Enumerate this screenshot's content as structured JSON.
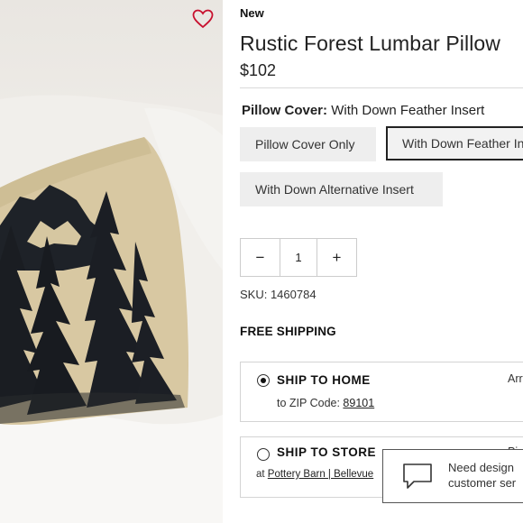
{
  "product": {
    "badge": "New",
    "title": "Rustic Forest Lumbar Pillow",
    "price": "$102",
    "wishlist_icon": "heart-icon",
    "option_label": "Pillow Cover:",
    "option_selected": "With Down Feather Insert",
    "options": [
      {
        "label": "Pillow Cover Only",
        "selected": false
      },
      {
        "label": "With Down Feather Insert",
        "selected": true
      },
      {
        "label": "With Down Alternative Insert",
        "selected": false
      }
    ],
    "quantity": {
      "minus": "−",
      "value": "1",
      "plus": "+"
    },
    "sku": "SKU: 1460784"
  },
  "shipping": {
    "heading": "FREE SHIPPING",
    "home": {
      "title": "SHIP TO HOME",
      "sub_prefix": "to ZIP Code: ",
      "zip": "89101",
      "right": "Arr",
      "selected": true
    },
    "store": {
      "title": "SHIP TO STORE",
      "sub_prefix": "at ",
      "store_link": "Pottery Barn | Bellevue",
      "right": "Pi",
      "selected": false
    }
  },
  "chat": {
    "icon": "chat-bubble-icon",
    "line1": "Need design",
    "line2": "customer ser"
  },
  "colors": {
    "heart": "#c8102e",
    "accent_text": "#222222",
    "option_bg": "#eeeeee"
  }
}
